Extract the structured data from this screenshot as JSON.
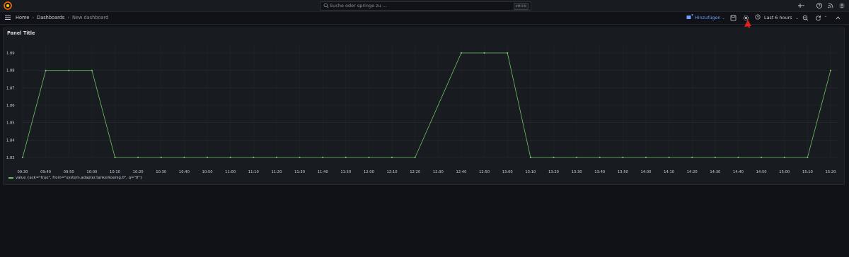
{
  "topbar": {
    "search_placeholder": "Suche oder springe zu ...",
    "search_shortcut": "ctrl+k"
  },
  "navbar": {
    "breadcrumbs": [
      "Home",
      "Dashboards",
      "New dashboard"
    ],
    "add_label": "Hinzufügen",
    "time_range": "Last 6 hours"
  },
  "panel": {
    "title": "Panel Title"
  },
  "chart_data": {
    "type": "line",
    "title": "Panel Title",
    "ylim": [
      1.83,
      1.89
    ],
    "y_ticks": [
      "1.89",
      "1.88",
      "1.87",
      "1.86",
      "1.85",
      "1.84",
      "1.83"
    ],
    "x_ticks": [
      "09:30",
      "09:40",
      "09:50",
      "10:00",
      "10:10",
      "10:20",
      "10:30",
      "10:40",
      "10:50",
      "11:00",
      "11:10",
      "11:20",
      "11:30",
      "11:40",
      "11:50",
      "12:00",
      "12:10",
      "12:20",
      "12:30",
      "12:40",
      "12:50",
      "13:00",
      "13:10",
      "13:20",
      "13:30",
      "13:40",
      "13:50",
      "14:00",
      "14:10",
      "14:20",
      "14:30",
      "14:40",
      "14:50",
      "15:00",
      "15:10",
      "15:20"
    ],
    "grid": true,
    "legend_placement": "bottom-left",
    "series": [
      {
        "name": "value {ack=\"true\", from=\"system.adapter.tankerkoenig.0\", q=\"0\"}",
        "color": "#73bf69",
        "x": [
          "09:30",
          "09:40",
          "09:50",
          "10:00",
          "10:10",
          "10:20",
          "10:30",
          "10:40",
          "10:50",
          "11:00",
          "11:10",
          "11:20",
          "11:30",
          "11:40",
          "11:50",
          "12:00",
          "12:10",
          "12:20",
          "12:40",
          "12:50",
          "13:00",
          "13:10",
          "13:20",
          "13:30",
          "13:40",
          "13:50",
          "14:00",
          "14:10",
          "14:20",
          "14:30",
          "14:40",
          "14:50",
          "15:00",
          "15:10",
          "15:20"
        ],
        "values": [
          1.83,
          1.88,
          1.88,
          1.88,
          1.83,
          1.83,
          1.83,
          1.83,
          1.83,
          1.83,
          1.83,
          1.83,
          1.83,
          1.83,
          1.83,
          1.83,
          1.83,
          1.83,
          1.89,
          1.89,
          1.89,
          1.83,
          1.83,
          1.83,
          1.83,
          1.83,
          1.83,
          1.83,
          1.83,
          1.83,
          1.83,
          1.83,
          1.83,
          1.83,
          1.88
        ]
      }
    ]
  }
}
